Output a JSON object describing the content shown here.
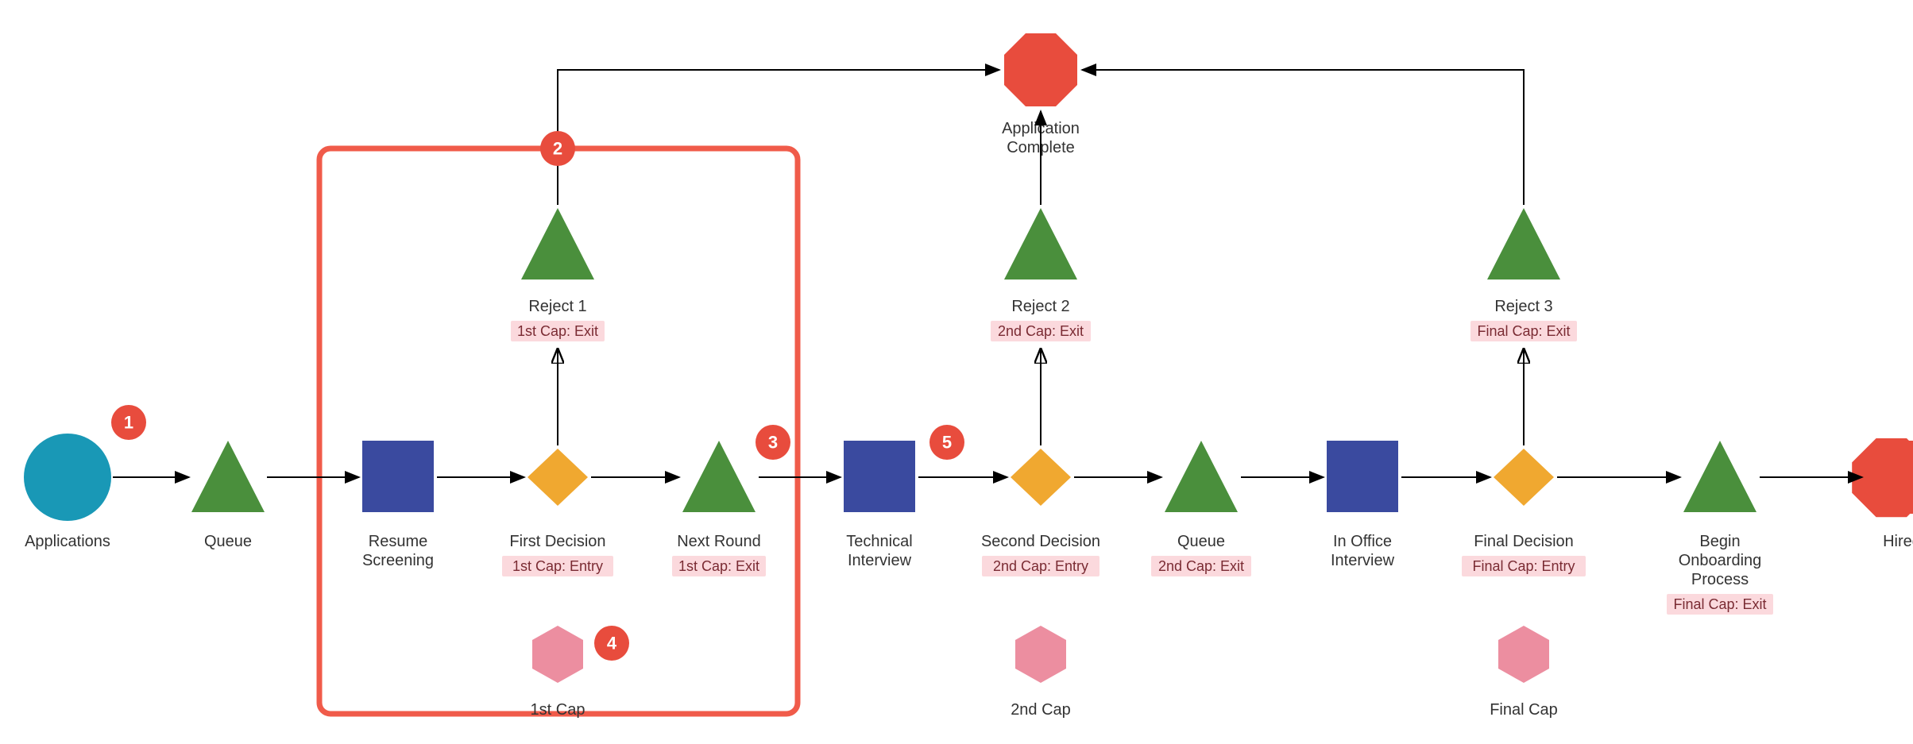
{
  "diagram": {
    "nodes": {
      "applications": {
        "label": "Applications"
      },
      "queue1": {
        "label": "Queue"
      },
      "resume_screening": {
        "label_line1": "Resume",
        "label_line2": "Screening"
      },
      "first_decision": {
        "label": "First Decision",
        "tag": "1st Cap: Entry"
      },
      "reject1": {
        "label": "Reject 1",
        "tag": "1st Cap: Exit"
      },
      "next_round": {
        "label": "Next Round",
        "tag": "1st Cap: Exit"
      },
      "technical_interview": {
        "label_line1": "Technical",
        "label_line2": "Interview"
      },
      "second_decision": {
        "label": "Second Decision",
        "tag": "2nd Cap: Entry"
      },
      "reject2": {
        "label": "Reject 2",
        "tag": "2nd Cap: Exit"
      },
      "queue2": {
        "label": "Queue",
        "tag": "2nd Cap: Exit"
      },
      "in_office_interview": {
        "label_line1": "In Office",
        "label_line2": "Interview"
      },
      "final_decision": {
        "label": "Final Decision",
        "tag": "Final Cap: Entry"
      },
      "reject3": {
        "label": "Reject 3",
        "tag": "Final Cap: Exit"
      },
      "begin_onboarding": {
        "label_line1": "Begin",
        "label_line2": "Onboarding",
        "label_line3": "Process",
        "tag": "Final Cap: Exit"
      },
      "hired": {
        "label": "Hired"
      },
      "application_complete": {
        "label_line1": "Application",
        "label_line2": "Complete"
      },
      "cap1": {
        "label": "1st Cap"
      },
      "cap2": {
        "label": "2nd Cap"
      },
      "cap3": {
        "label": "Final Cap"
      }
    },
    "callouts": {
      "c1": "1",
      "c2": "2",
      "c3": "3",
      "c4": "4",
      "c5": "5"
    },
    "colors": {
      "source": "#1998b6",
      "queue": "#4a8f3c",
      "process": "#3a4a9f",
      "decision": "#f0a830",
      "sink": "#e84c3d",
      "cap": "#ec8ea0",
      "group": "#f05b4a",
      "tag_bg": "#fbd9dd",
      "tag_text": "#7a2b33"
    }
  }
}
